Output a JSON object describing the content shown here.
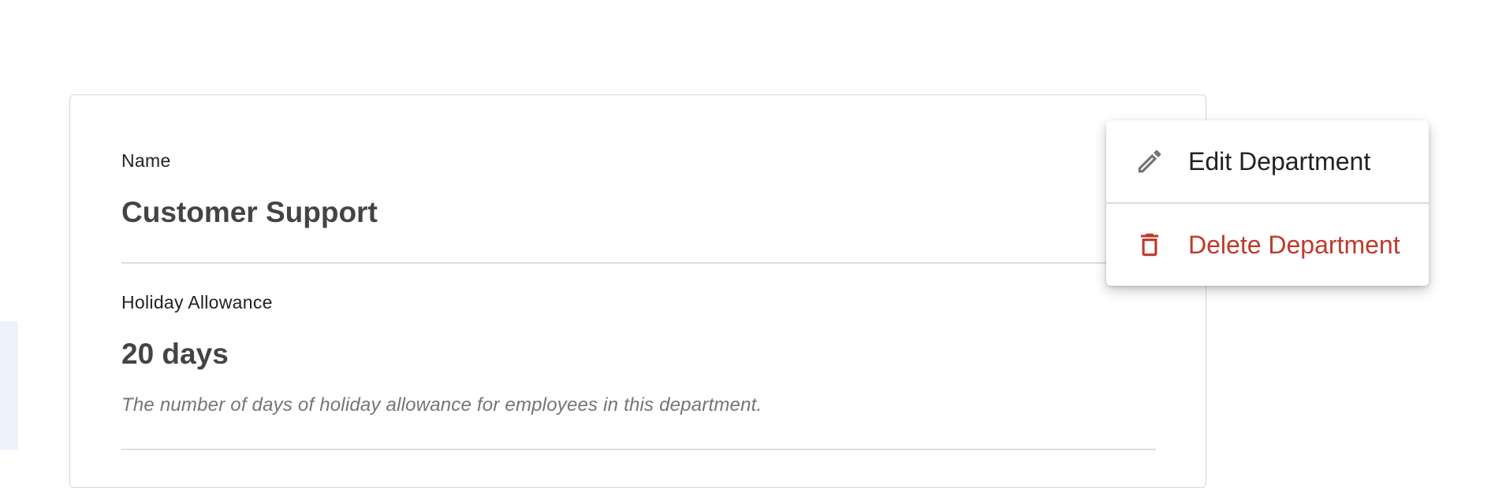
{
  "details": {
    "name_label": "Name",
    "name_value": "Customer Support",
    "holiday_label": "Holiday Allowance",
    "holiday_value": "20 days",
    "holiday_help": "The number of days of holiday allowance for employees in this department."
  },
  "menu": {
    "items": [
      {
        "label": "Edit Department",
        "icon": "pencil-icon",
        "color": "#222222",
        "icon_color": "#757575"
      },
      {
        "label": "Delete Department",
        "icon": "trash-icon",
        "color": "#c0392b",
        "icon_color": "#c0392b"
      }
    ]
  }
}
